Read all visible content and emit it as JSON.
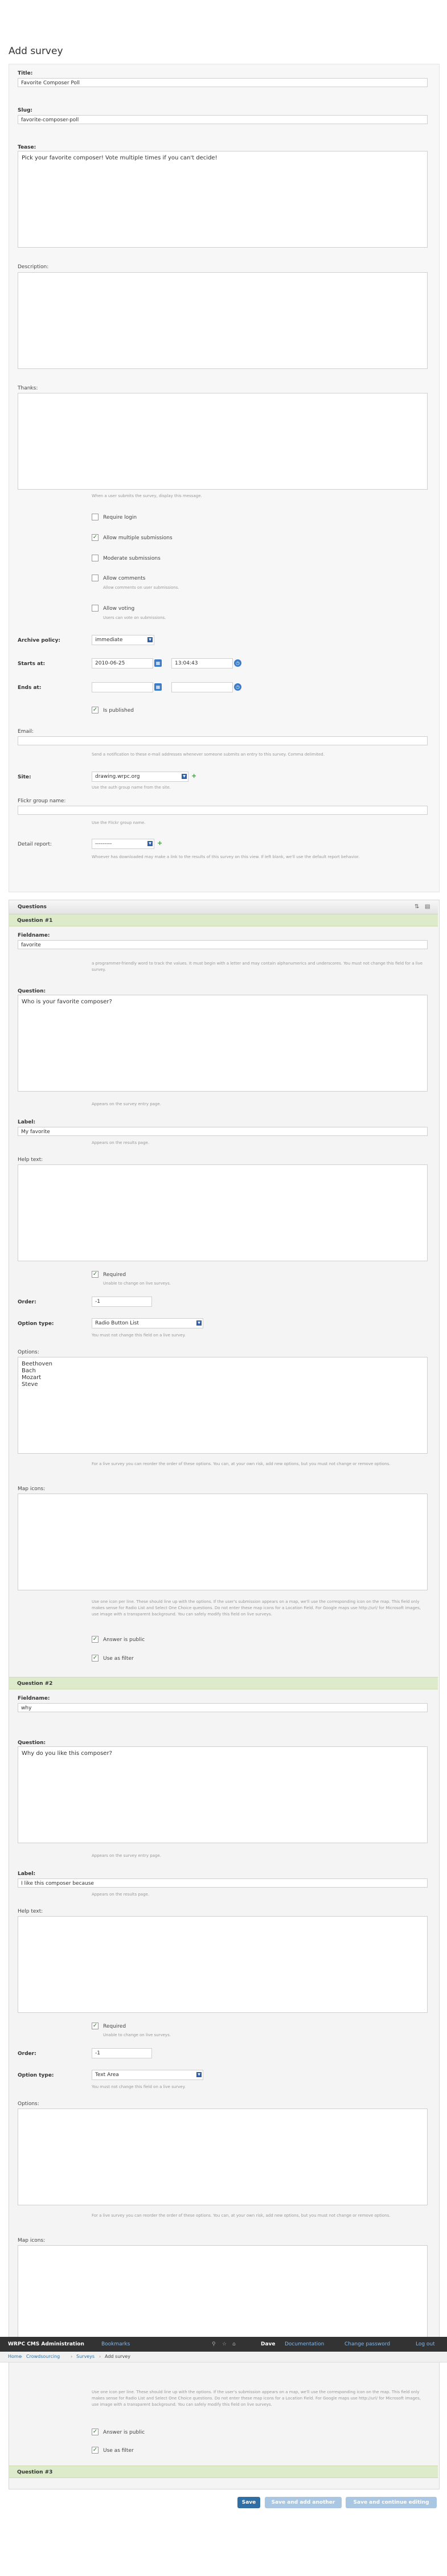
{
  "page": {
    "title": "Add survey"
  },
  "survey": {
    "title_label": "Title:",
    "title_value": "Favorite Composer Poll",
    "slug_label": "Slug:",
    "slug_value": "favorite-composer-poll",
    "tease_label": "Tease:",
    "tease_value": "Pick your favorite composer! Vote multiple times if you can't decide!",
    "description_label": "Description:",
    "thanks_label": "Thanks:",
    "thanks_help": "When a user submits the survey, display this message.",
    "require_login": "Require login",
    "allow_multiple": "Allow multiple submissions",
    "moderate": "Moderate submissions",
    "allow_comments": "Allow comments",
    "allow_comments_help": "Allow comments on user submissions.",
    "allow_voting": "Allow voting",
    "allow_voting_help": "Users can vote on submissions.",
    "archive_policy_label": "Archive policy:",
    "archive_policy_value": "immediate",
    "starts_label": "Starts at:",
    "starts_date": "2010-06-25",
    "starts_time": "13:04:43",
    "ends_label": "Ends at:",
    "is_published": "Is published",
    "email_label": "Email:",
    "email_help": "Send a notification to these e-mail addresses whenever someone submits an entry to this survey. Comma delimited.",
    "site_label": "Site:",
    "site_value": "drawing.wrpc.org",
    "site_help": "Use the auth group name from the site.",
    "flickr_label": "Flickr group name:",
    "flickr_help": "Use the Flickr group name.",
    "detail_label": "Detail report:",
    "detail_value": "---------",
    "detail_help": "Whoever has downloaded may make a link to the results of this survey on this view. If left blank, we'll use the default report behavior."
  },
  "questions": {
    "bar_title": "Questions",
    "common": {
      "fieldname_label": "Fieldname:",
      "fieldname_help": "a programmer-friendly word to track the values. It must begin with a letter and may contain alphanumerics and underscores. You must not change this field for a live survey.",
      "question_label": "Question:",
      "question_help": "Appears on the survey entry page.",
      "label_label": "Label:",
      "label_help": "Appears on the results page.",
      "help_label": "Help text:",
      "required": "Required",
      "required_help": "Unable to change on live surveys.",
      "order_label": "Order:",
      "option_type_label": "Option type:",
      "option_type_help": "You must not change this field on a live survey.",
      "options_label": "Options:",
      "options_help": "For a live survey you can reorder the order of these options. You can, at your own risk, add new options, but you must not change or remove options.",
      "map_icons_label": "Map icons:",
      "map_icons_help": "Use one icon per line. These should line up with the options. If the user's submission appears on a map, we'll use the corresponding icon on the map. This field only makes sense for Radio List and Select One Choice questions. Do not enter these map icons for a Location Field. For Google maps use http://url/ for Microsoft images, use image with a transparent background. You can safely modify this field on live surveys.",
      "answer_public": "Answer is public",
      "use_as_filter": "Use as filter"
    },
    "items": [
      {
        "header": "Question #1",
        "fieldname": "favorite",
        "question": "Who is your favorite composer?",
        "label": "My favorite",
        "order": "-1",
        "option_type": "Radio Button List",
        "options": "Beethoven\nBach\nMozart\nSteve"
      },
      {
        "header": "Question #2",
        "fieldname": "why",
        "question": "Why do you like this composer?",
        "label": "I like this composer because",
        "order": "-1",
        "option_type": "Text Area",
        "options": ""
      },
      {
        "header": "Question #3"
      }
    ]
  },
  "topbar": {
    "brand": "WRPC CMS Administration",
    "bookmarks": "Bookmarks",
    "user": "Dave",
    "documentation": "Documentation",
    "change_password": "Change password",
    "logout": "Log out"
  },
  "breadcrumb": {
    "home": "Home",
    "app": "Crowdsourcing",
    "section": "Surveys",
    "current": "Add survey"
  },
  "buttons": {
    "save": "Save",
    "save_add_another": "Save and add another",
    "save_continue": "Save and continue editing"
  },
  "colors": {
    "accent": "#2f6fa5",
    "question_header": "#deebcb",
    "topbar": "#333333"
  }
}
